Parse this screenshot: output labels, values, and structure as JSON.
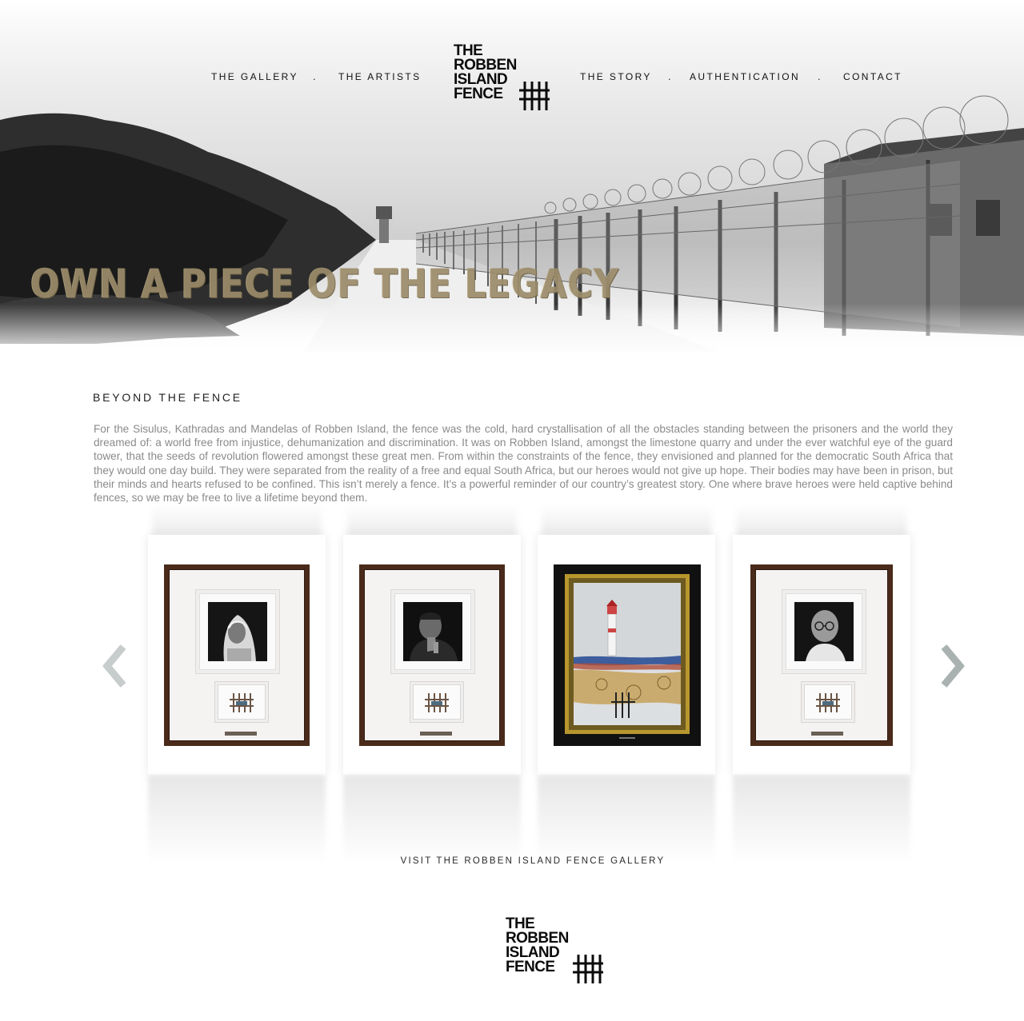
{
  "brand": {
    "logo_lines": [
      "THE",
      "ROBBEN",
      "ISLAND",
      "FENCE"
    ],
    "logo_mark": "fence-hash-icon"
  },
  "nav": {
    "items": [
      {
        "label": "THE GALLERY"
      },
      {
        "label": "THE ARTISTS"
      },
      {
        "label": "THE STORY"
      },
      {
        "label": "AUTHENTICATION"
      },
      {
        "label": "CONTACT"
      }
    ],
    "separator": "."
  },
  "hero": {
    "tagline": "OWN A PIECE OF THE LEGACY",
    "tagline_color": "#9c8c6a"
  },
  "intro": {
    "title": "BEYOND THE FENCE",
    "body": "For the Sisulus, Kathradas and Mandelas of Robben Island, the fence was the cold, hard crystallisation of all the obstacles standing between the prisoners and the world they dreamed of: a world free from injustice, dehumanization and discrimination. It was on Robben Island, amongst the limestone quarry and under the ever watchful eye of the guard tower, that the seeds of revolution flowered amongst these great men. From within the constraints of the fence, they envisioned and planned for the democratic South Africa that they would one day build. They were separated from the reality of a free and equal South Africa, but our heroes would not give up hope. Their bodies may have been in prison, but their minds and hearts refused to be confined. This isn’t merely a fence. It’s a powerful reminder of our country’s greatest story. One where brave heroes were held captive behind fences, so we may be free to live a lifetime beyond them."
  },
  "carousel": {
    "prev_icon": "chevron-left-icon",
    "next_icon": "chevron-right-icon",
    "items": [
      {
        "type": "portrait-frame",
        "subject": "woman-in-headscarf-portrait"
      },
      {
        "type": "portrait-frame",
        "subject": "man-with-hand-on-chin-portrait"
      },
      {
        "type": "painting-frame",
        "subject": "lighthouse-painting"
      },
      {
        "type": "portrait-frame",
        "subject": "man-with-glasses-portrait"
      }
    ],
    "frame_color": "#4a2a1a"
  },
  "gallery_link": {
    "label": "VISIT THE ROBBEN ISLAND FENCE GALLERY"
  }
}
